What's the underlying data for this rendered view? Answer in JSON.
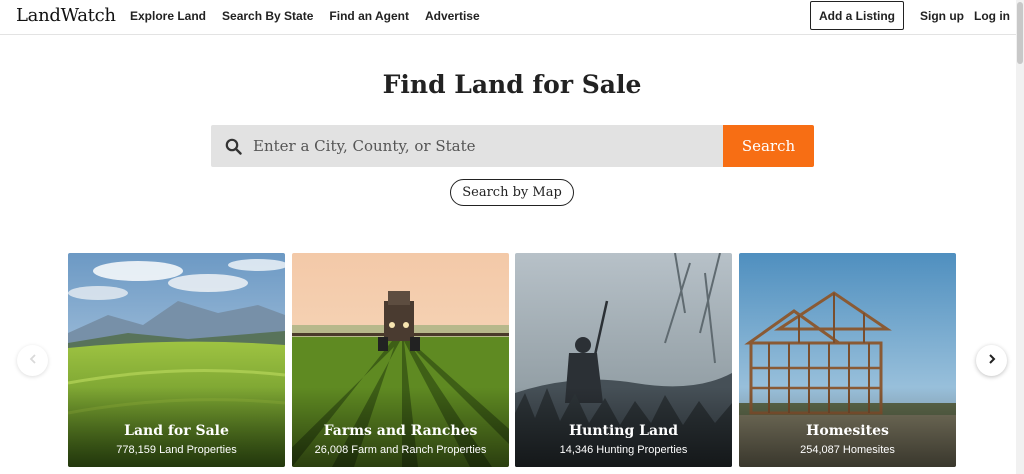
{
  "header": {
    "logo": "LandWatch",
    "nav": [
      "Explore Land",
      "Search By State",
      "Find an Agent",
      "Advertise"
    ],
    "add_listing": "Add a Listing",
    "sign_up": "Sign up",
    "log_in": "Log in"
  },
  "hero": {
    "title": "Find Land for Sale",
    "search_placeholder": "Enter a City, County, or State",
    "search_button": "Search",
    "map_button": "Search by Map"
  },
  "cards": [
    {
      "title": "Land for Sale",
      "count": "778,159 Land Properties"
    },
    {
      "title": "Farms and Ranches",
      "count": "26,008 Farm and Ranch Properties"
    },
    {
      "title": "Hunting Land",
      "count": "14,346 Hunting Properties"
    },
    {
      "title": "Homesites",
      "count": "254,087 Homesites"
    }
  ],
  "colors": {
    "accent": "#f76e14",
    "search_bg": "#e2e2e2"
  },
  "icons": {
    "search": "search-icon",
    "prev": "chevron-left-icon",
    "next": "chevron-right-icon"
  }
}
